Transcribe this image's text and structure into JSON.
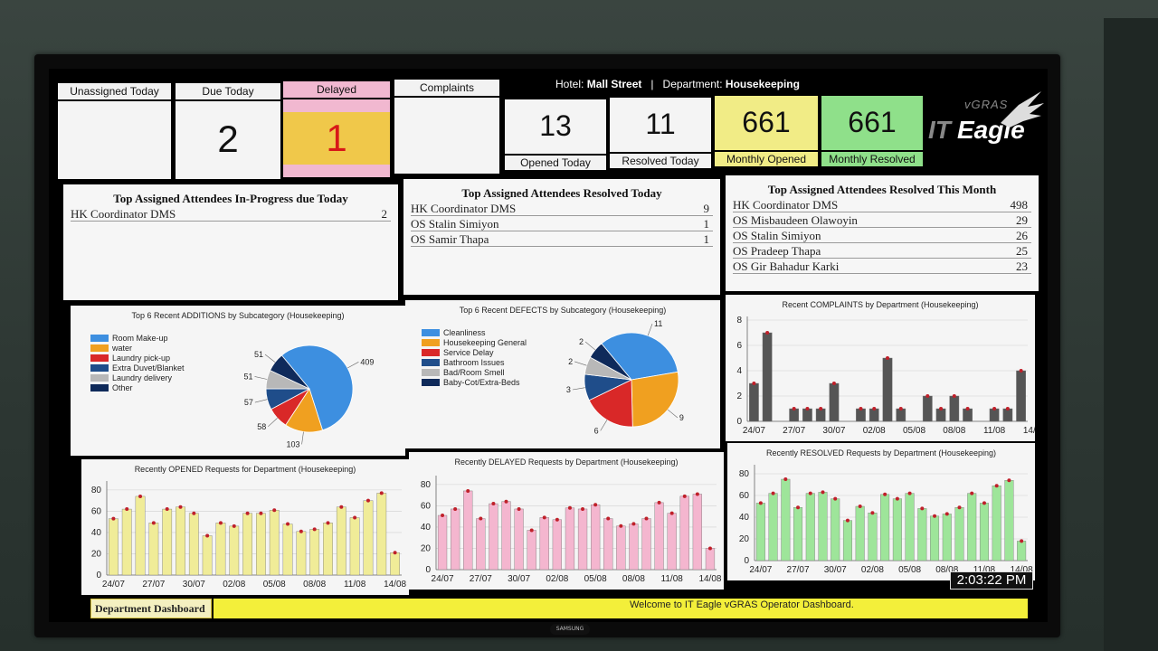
{
  "hotel": {
    "label": "Hotel:",
    "name": "Mall Street",
    "sep": "|",
    "dept_label": "Department:",
    "dept_name": "Housekeeping"
  },
  "logo": {
    "top": "vGRAS",
    "it": "IT",
    "eagle": "Eagle"
  },
  "kpis": {
    "unassigned": {
      "label": "Unassigned Today",
      "value": ""
    },
    "due": {
      "label": "Due Today",
      "value": "2"
    },
    "delayed": {
      "label": "Delayed",
      "value": "1"
    },
    "complaints": {
      "label": "Complaints",
      "value": ""
    },
    "opened": {
      "label": "Opened Today",
      "value": "13"
    },
    "resolved": {
      "label": "Resolved Today",
      "value": "11"
    },
    "monthly_opened": {
      "label": "Monthly Opened",
      "value": "661"
    },
    "monthly_resolved": {
      "label": "Monthly Resolved",
      "value": "661"
    }
  },
  "tables": {
    "in_progress": {
      "title": "Top Assigned Attendees In-Progress due Today",
      "rows": [
        [
          "HK Coordinator DMS",
          "2"
        ]
      ]
    },
    "resolved_today": {
      "title": "Top Assigned Attendees Resolved Today",
      "rows": [
        [
          "HK Coordinator DMS",
          "9"
        ],
        [
          "OS Stalin Simiyon",
          "1"
        ],
        [
          "OS Samir Thapa",
          "1"
        ]
      ]
    },
    "resolved_month": {
      "title": "Top Assigned Attendees Resolved This Month",
      "rows": [
        [
          "HK Coordinator DMS",
          "498"
        ],
        [
          "OS Misbaudeen Olawoyin",
          "29"
        ],
        [
          "OS Stalin Simiyon",
          "26"
        ],
        [
          "OS Pradeep Thapa",
          "25"
        ],
        [
          "OS Gir Bahadur Karki",
          "23"
        ]
      ]
    }
  },
  "colors": {
    "blue": "#3d8fe0",
    "orange": "#f0a020",
    "red": "#d92828",
    "navy": "#1f4d8a",
    "gray": "#b8b8b8",
    "darknavy": "#0f2a5a",
    "yellow_bar": "#f0ec98",
    "pink_bar": "#f4b6cf",
    "green_bar": "#9ee59a",
    "dark_bar": "#555555"
  },
  "chart_data": [
    {
      "type": "pie",
      "title": "Top 6 Recent ADDITIONS by Subcategory (Housekeeping)",
      "labels": [
        "Room Make-up",
        "water",
        "Laundry pick-up",
        "Extra Duvet/Blanket",
        "Laundry delivery",
        "Other"
      ],
      "values": [
        409,
        103,
        58,
        57,
        51,
        51
      ],
      "colors": [
        "#3d8fe0",
        "#f0a020",
        "#d92828",
        "#1f4d8a",
        "#b8b8b8",
        "#0f2a5a"
      ]
    },
    {
      "type": "pie",
      "title": "Top 6 Recent DEFECTS by Subcategory (Housekeeping)",
      "labels": [
        "Cleanliness",
        "Housekeeping General",
        "Service Delay",
        "Bathroom Issues",
        "Bad/Room Smell",
        "Baby-Cot/Extra-Beds"
      ],
      "values": [
        11,
        9,
        6,
        3,
        2,
        2
      ],
      "colors": [
        "#3d8fe0",
        "#f0a020",
        "#d92828",
        "#1f4d8a",
        "#b8b8b8",
        "#0f2a5a"
      ]
    },
    {
      "type": "bar",
      "title": "Recent COMPLAINTS by Department (Housekeeping)",
      "x_ticks": [
        "24/07",
        "27/07",
        "30/07",
        "02/08",
        "05/08",
        "08/08",
        "11/08",
        "14/08"
      ],
      "values": [
        3,
        7,
        0,
        1,
        1,
        1,
        3,
        0,
        1,
        1,
        5,
        1,
        0,
        2,
        1,
        2,
        1,
        0,
        1,
        1,
        4
      ],
      "yticks": [
        0,
        2,
        4,
        6,
        8
      ],
      "ylim": [
        0,
        8
      ],
      "color": "#555555"
    },
    {
      "type": "bar",
      "title": "Recently OPENED Requests for Department (Housekeeping)",
      "x_ticks": [
        "24/07",
        "27/07",
        "30/07",
        "02/08",
        "05/08",
        "08/08",
        "11/08",
        "14/08"
      ],
      "values": [
        53,
        62,
        74,
        49,
        62,
        64,
        58,
        37,
        49,
        46,
        58,
        58,
        61,
        48,
        41,
        43,
        49,
        64,
        54,
        70,
        77,
        21
      ],
      "yticks": [
        0,
        20,
        40,
        60,
        80
      ],
      "ylim": [
        0,
        85
      ],
      "color": "#f0ec98"
    },
    {
      "type": "bar",
      "title": "Recently DELAYED Requests by Department (Housekeeping)",
      "x_ticks": [
        "24/07",
        "27/07",
        "30/07",
        "02/08",
        "05/08",
        "08/08",
        "11/08",
        "14/08"
      ],
      "values": [
        51,
        57,
        74,
        48,
        62,
        64,
        57,
        37,
        49,
        47,
        58,
        57,
        61,
        48,
        41,
        43,
        48,
        63,
        53,
        69,
        71,
        20
      ],
      "yticks": [
        0,
        20,
        40,
        60,
        80
      ],
      "ylim": [
        0,
        85
      ],
      "color": "#f4b6cf"
    },
    {
      "type": "bar",
      "title": "Recently RESOLVED Requests by Department (Housekeeping)",
      "x_ticks": [
        "24/07",
        "27/07",
        "30/07",
        "02/08",
        "05/08",
        "08/08",
        "11/08",
        "14/08"
      ],
      "values": [
        53,
        62,
        75,
        49,
        62,
        63,
        57,
        37,
        50,
        44,
        61,
        57,
        62,
        48,
        41,
        43,
        49,
        62,
        53,
        69,
        74,
        18
      ],
      "yticks": [
        0,
        20,
        40,
        60,
        80
      ],
      "ylim": [
        0,
        85
      ],
      "color": "#9ee59a"
    }
  ],
  "footer": {
    "tab": "Department Dashboard",
    "marquee": "Welcome to IT Eagle vGRAS Operator Dashboard.",
    "clock": "2:03:22 PM"
  },
  "tv_brand": "SAMSUNG"
}
